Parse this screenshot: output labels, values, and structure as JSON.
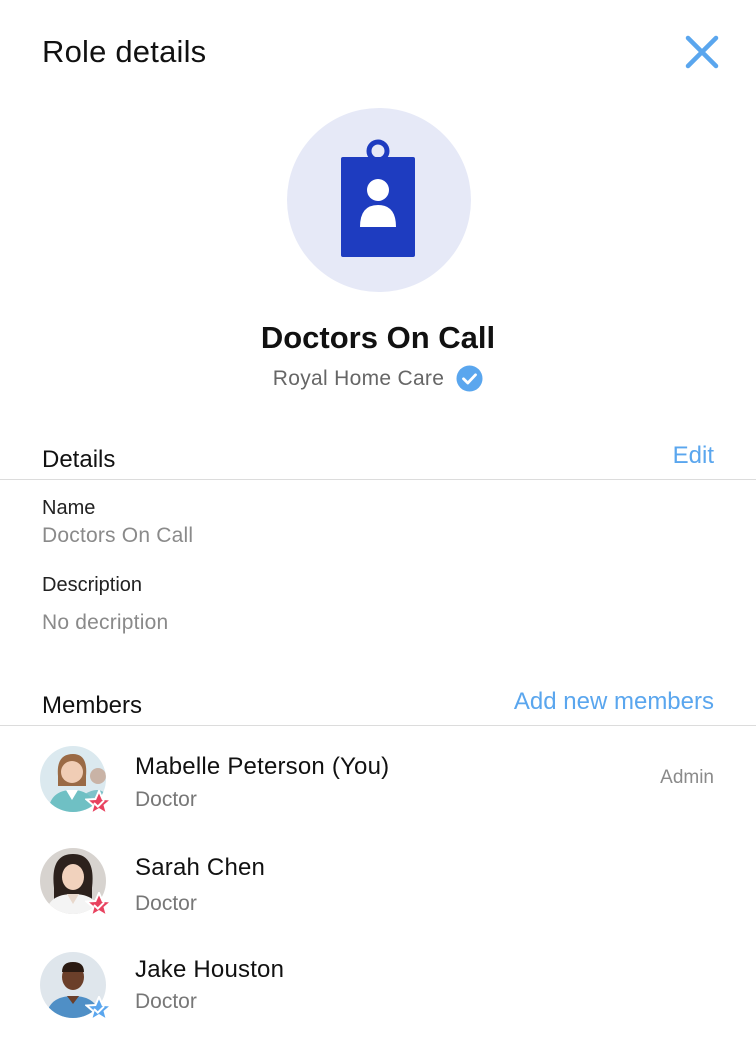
{
  "header": {
    "title": "Role details",
    "close_icon": "close-icon"
  },
  "role": {
    "icon": "id-badge-icon",
    "name": "Doctors On Call",
    "organization": "Royal Home Care",
    "verified_icon": "verified-check-icon"
  },
  "details": {
    "section_title": "Details",
    "edit_label": "Edit",
    "name_label": "Name",
    "name_value": "Doctors On Call",
    "description_label": "Description",
    "description_value": "No decription"
  },
  "members": {
    "section_title": "Members",
    "add_label": "Add new members",
    "items": [
      {
        "name": "Mabelle Peterson (You)",
        "role": "Doctor",
        "tag": "Admin",
        "badge_color": "#e8425f"
      },
      {
        "name": "Sarah Chen",
        "role": "Doctor",
        "tag": "",
        "badge_color": "#e8425f"
      },
      {
        "name": "Jake Houston",
        "role": "Doctor",
        "tag": "",
        "badge_color": "#5aa6ee"
      }
    ]
  },
  "colors": {
    "accent": "#5aa6ee",
    "role_icon": "#1e3cc0",
    "role_avatar_bg": "#e6e9f7"
  }
}
